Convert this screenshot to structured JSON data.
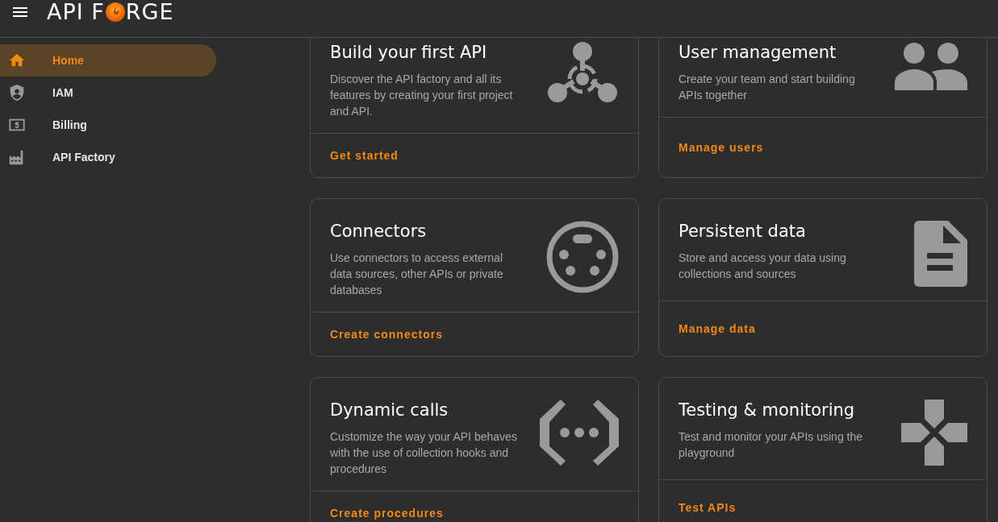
{
  "header": {
    "logo_left": "API F",
    "logo_right": "RGE"
  },
  "sidebar": {
    "items": [
      {
        "label": "Home",
        "selected": true
      },
      {
        "label": "IAM",
        "selected": false
      },
      {
        "label": "Billing",
        "selected": false
      },
      {
        "label": "API Factory",
        "selected": false
      }
    ]
  },
  "cards": [
    {
      "title": "Build your first API",
      "description": "Discover the API factory and all its features by creating your first project and API.",
      "action": "Get started"
    },
    {
      "title": "User management",
      "description": "Create your team and start building APIs together",
      "action": "Manage users"
    },
    {
      "title": "Connectors",
      "description": "Use connectors to access external data sources, other APIs or private databases",
      "action": "Create connectors"
    },
    {
      "title": "Persistent data",
      "description": "Store and access your data using collections and sources",
      "action": "Manage data"
    },
    {
      "title": "Dynamic calls",
      "description": "Customize the way your API behaves with the use of collection hooks and procedures",
      "action": "Create procedures"
    },
    {
      "title": "Testing & monitoring",
      "description": "Test and monitor your APIs using the playground",
      "action": "Test APIs"
    }
  ]
}
